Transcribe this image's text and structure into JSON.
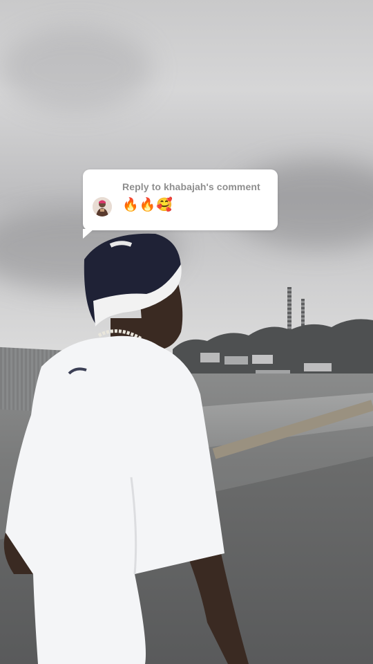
{
  "reply_sticker": {
    "header": "Reply to khabajah's comment",
    "comment_text": "🔥🔥🥰",
    "avatar_icon": "user-avatar-icon"
  },
  "colors": {
    "sticker_background": "#ffffff",
    "sticker_header": "#8e8e8e",
    "comment_text": "#161823"
  }
}
